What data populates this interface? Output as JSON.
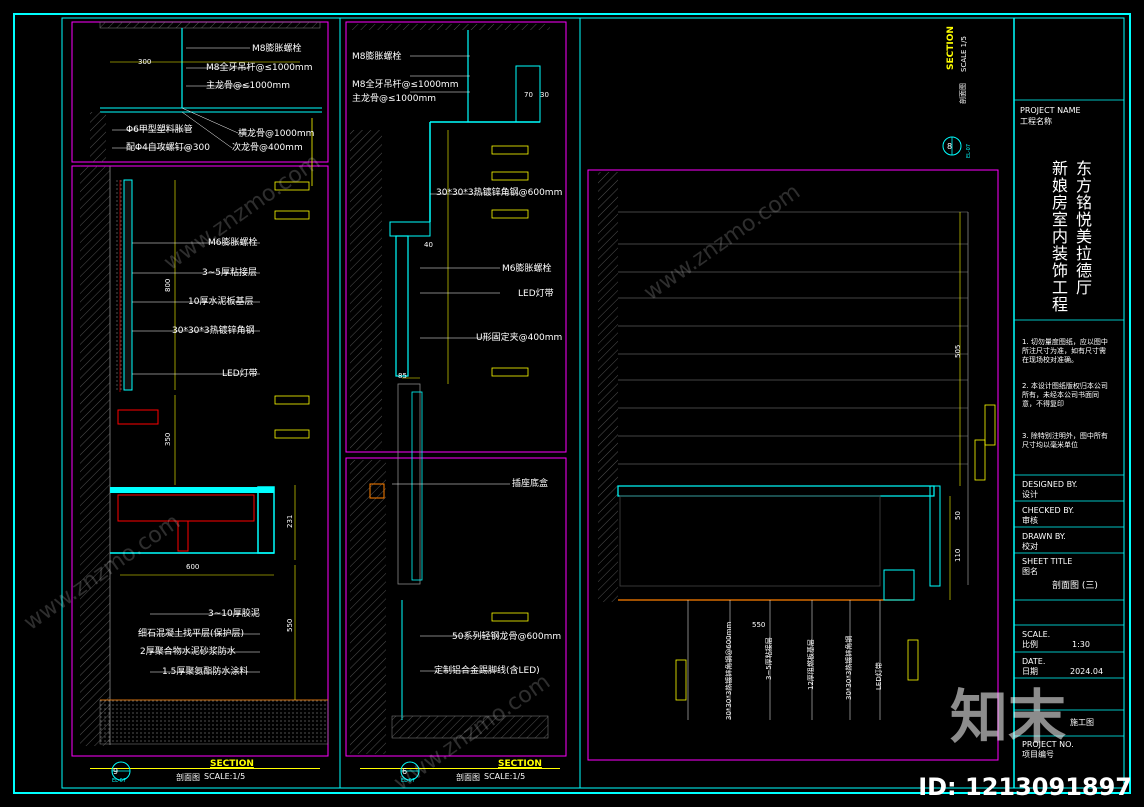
{
  "watermark": "www.znzmo.com",
  "id_text": "ID: 1213091897",
  "logo_text": "知末",
  "panel1": {
    "labels": [
      "M8膨胀螺栓",
      "M8全牙吊杆@≤1000mm",
      "主龙骨@≤1000mm",
      "Φ6甲型塑料胀管",
      "配Φ4自攻螺钉@300",
      "横龙骨@1000mm",
      "次龙骨@400mm",
      "M6膨胀螺栓",
      "3~5厚粘接层",
      "10厚水泥板基层",
      "30*30*3热镀锌角钢",
      "LED灯带",
      "3~10厚胶泥",
      "细石混凝土找平层(保护层)",
      "2厚聚合物水泥砂浆防水",
      "1.5厚聚氨酯防水涂料"
    ],
    "dims": [
      "300",
      "800",
      "350",
      "600",
      "231",
      "550"
    ],
    "section_title": "SECTION",
    "section_sub": "剖面图",
    "section_scale": "SCALE:1/5",
    "bubble_num": "9",
    "bubble_ref": "EL-07"
  },
  "panel2": {
    "labels": [
      "M8膨胀螺栓",
      "M8全牙吊杆@≤1000mm",
      "主龙骨@≤1000mm",
      "30*30*3热镀锌角钢@600mm",
      "M6膨胀螺栓",
      "LED灯带",
      "U形固定夹@400mm",
      "插座底盒",
      "50系列轻钢龙骨@600mm",
      "定制铝合金踢脚线(含LED)"
    ],
    "dims": [
      "70",
      "30",
      "40",
      "85"
    ],
    "section_title": "SECTION",
    "section_sub": "剖面图",
    "section_scale": "SCALE:1/5",
    "bubble_num": "6",
    "bubble_ref": "EL-07"
  },
  "panel3": {
    "top_title": "SECTION",
    "top_scale": "SCALE 1/5",
    "top_sub": "剖面图",
    "bubble_num": "8",
    "bubble_ref": "EL-07",
    "dims": [
      "505",
      "550",
      "50",
      "110"
    ],
    "rot_labels": [
      "30*30*3热镀锌角钢@600mm",
      "3~5厚粘接层",
      "12厚阻燃板基层",
      "30*30*3热镀锌角钢",
      "LED灯带"
    ]
  },
  "title_block": {
    "project_name_en": "PROJECT NAME",
    "project_name_cn": "工程名称",
    "project_title_1": "东方铭悦美拉德厅",
    "project_title_2": "新娘房室内装饰工程",
    "notes": [
      "1. 切勿量度图纸，应以图中所注尺寸为准，如有尺寸需在现场校对准确。",
      "2. 本设计图纸版权归本公司所有，未经本公司书面同意，不得复印",
      "3. 除特别注明外，图中所有尺寸均以毫米单位"
    ],
    "designed_en": "DESIGNED BY.",
    "designed_cn": "设计",
    "checked_en": "CHECKED BY.",
    "checked_cn": "审核",
    "drawn_en": "DRAWN BY.",
    "drawn_cn": "校对",
    "sheet_en": "SHEET TITLE",
    "sheet_cn": "图名",
    "sheet_value": "剖面图 (三)",
    "scale_en": "SCALE.",
    "scale_cn": "比例",
    "scale_value": "1:30",
    "date_en": "DATE.",
    "date_cn": "日期",
    "date_value": "2024.04",
    "phase_value": "施工图",
    "project_no_en": "PROJECT NO.",
    "project_no_cn": "项目编号"
  },
  "colors": {
    "frame": "#00ffff",
    "magenta": "#ff00ff",
    "yellow": "#ffff00",
    "red": "#ff0000",
    "blue": "#0000ff",
    "green": "#00ff00",
    "orange": "#ff8000"
  }
}
